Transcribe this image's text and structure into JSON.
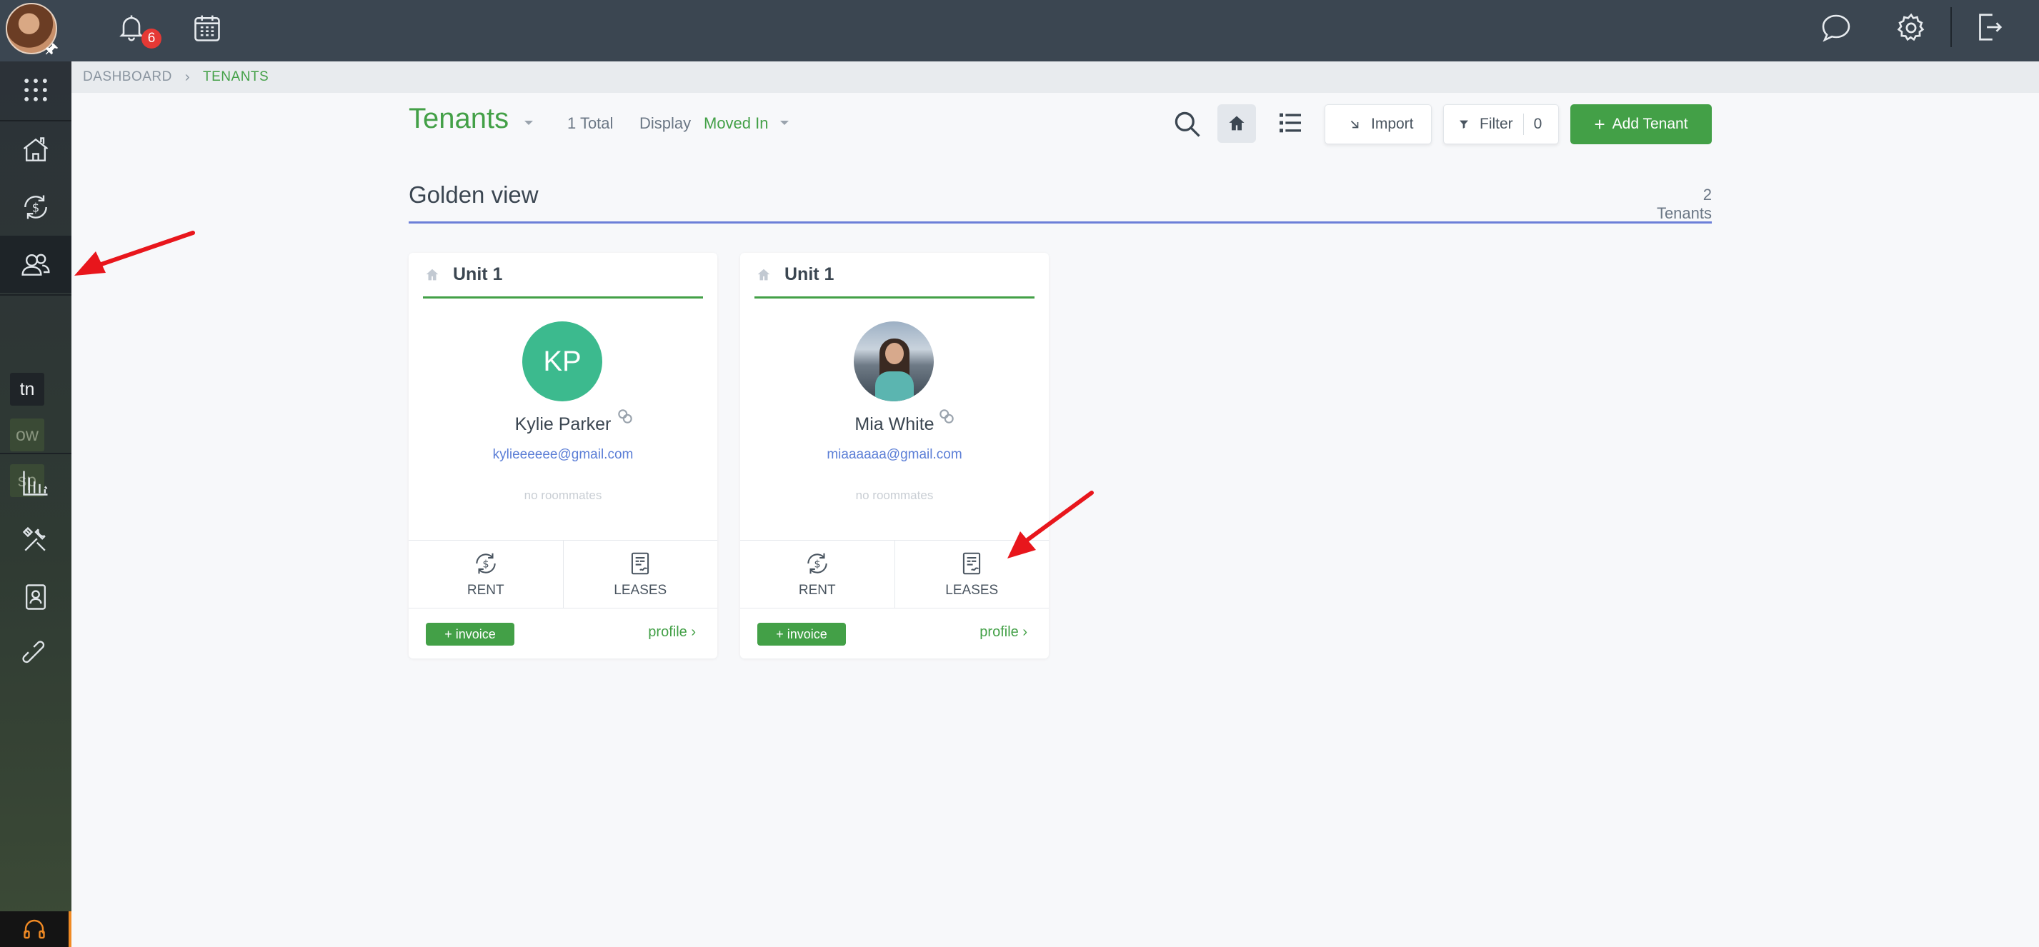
{
  "topbar": {
    "notification_count": "6",
    "icons": [
      "avatar",
      "pin-icon",
      "bell-icon",
      "calendar-icon",
      "chat-icon",
      "gear-icon",
      "logout-icon"
    ]
  },
  "sidebar": {
    "items": [
      {
        "name": "apps-grid-icon"
      },
      {
        "name": "properties-icon"
      },
      {
        "name": "rent-icon"
      },
      {
        "name": "tenants-icon",
        "active": true
      },
      {
        "name": "reports-icon"
      },
      {
        "name": "maintenance-icon"
      },
      {
        "name": "contacts-icon"
      },
      {
        "name": "integrations-icon"
      }
    ],
    "tags": {
      "tn": "tn",
      "ow": "ow",
      "sp": "sp"
    },
    "support_icon": "headset-icon"
  },
  "breadcrumb": {
    "dashboard": "DASHBOARD",
    "current": "TENANTS"
  },
  "header": {
    "title": "Tenants",
    "total": "1 Total",
    "display_label": "Display",
    "display_value": "Moved In",
    "import_label": "Import",
    "filter_label": "Filter",
    "filter_count": "0",
    "add_label": "Add Tenant"
  },
  "group": {
    "title": "Golden view",
    "count": "2 Tenants"
  },
  "tenants": [
    {
      "unit": "Unit 1",
      "initials": "KP",
      "name": "Kylie Parker",
      "email": "kylieeeeee@gmail.com",
      "roommates": "no roommates",
      "rent_label": "RENT",
      "leases_label": "LEASES",
      "invoice_label": "+ invoice",
      "profile_label": "profile"
    },
    {
      "unit": "Unit 1",
      "initials": "",
      "name": "Mia White",
      "email": "miaaaaaa@gmail.com",
      "roommates": "no roommates",
      "rent_label": "RENT",
      "leases_label": "LEASES",
      "invoice_label": "+ invoice",
      "profile_label": "profile"
    }
  ],
  "colors": {
    "brand_green": "#43a047",
    "topbar": "#3b4651",
    "accent_blue": "#6c7fd8",
    "annotation_red": "#e8161c"
  }
}
